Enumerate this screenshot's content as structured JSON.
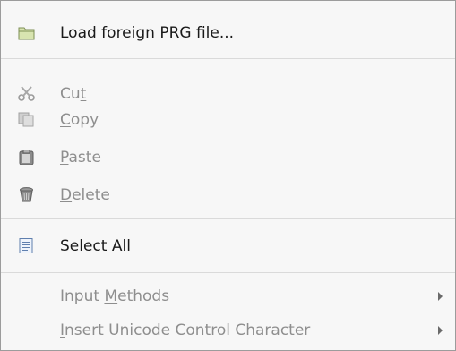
{
  "menu": {
    "load": {
      "label": "Load foreign PRG file...",
      "icon": "folder-icon"
    },
    "cut": {
      "pre": "Cu",
      "accel": "t",
      "post": "",
      "icon": "scissors-icon"
    },
    "copy": {
      "pre": "",
      "accel": "C",
      "post": "opy",
      "icon": "copy-icon"
    },
    "paste": {
      "pre": "",
      "accel": "P",
      "post": "aste",
      "icon": "paste-icon"
    },
    "delete": {
      "pre": "",
      "accel": "D",
      "post": "elete",
      "icon": "trash-icon"
    },
    "select_all": {
      "pre": "Select ",
      "accel": "A",
      "post": "ll",
      "icon": "document-icon"
    },
    "input_methods": {
      "pre": "Input ",
      "accel": "M",
      "post": "ethods"
    },
    "insert_unicode": {
      "pre": "",
      "accel": "I",
      "post": "nsert Unicode Control Character"
    }
  },
  "colors": {
    "enabled_text": "#1a1a1a",
    "disabled_text": "#8e8e8e",
    "menu_bg": "#f7f7f7"
  }
}
